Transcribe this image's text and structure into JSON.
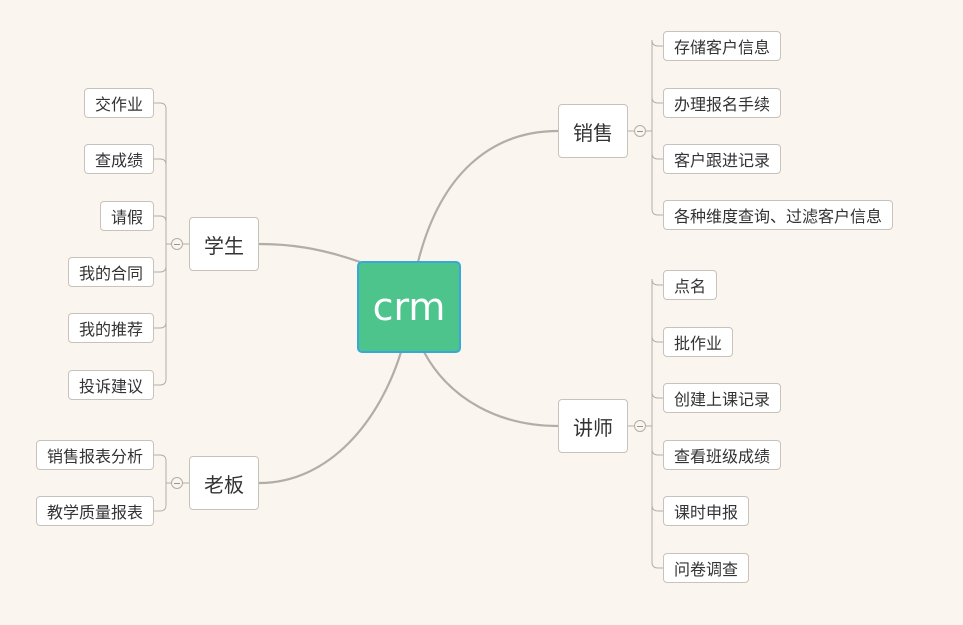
{
  "root": {
    "label": "crm"
  },
  "branches": [
    {
      "id": "sales",
      "label": "销售",
      "items": [
        "存储客户信息",
        "办理报名手续",
        "客户跟进记录",
        "各种维度查询、过滤客户信息"
      ]
    },
    {
      "id": "teacher",
      "label": "讲师",
      "items": [
        "点名",
        "批作业",
        "创建上课记录",
        "查看班级成绩",
        "课时申报",
        "问卷调查"
      ]
    },
    {
      "id": "student",
      "label": "学生",
      "items": [
        "交作业",
        "查成绩",
        "请假",
        "我的合同",
        "我的推荐",
        "投诉建议"
      ]
    },
    {
      "id": "boss",
      "label": "老板",
      "items": [
        "销售报表分析",
        "教学质量报表"
      ]
    }
  ],
  "colors": {
    "background": "#fbf5f0",
    "root_fill": "#4dc48c",
    "root_border": "#3aa7d9",
    "connector": "#b3ada8"
  }
}
